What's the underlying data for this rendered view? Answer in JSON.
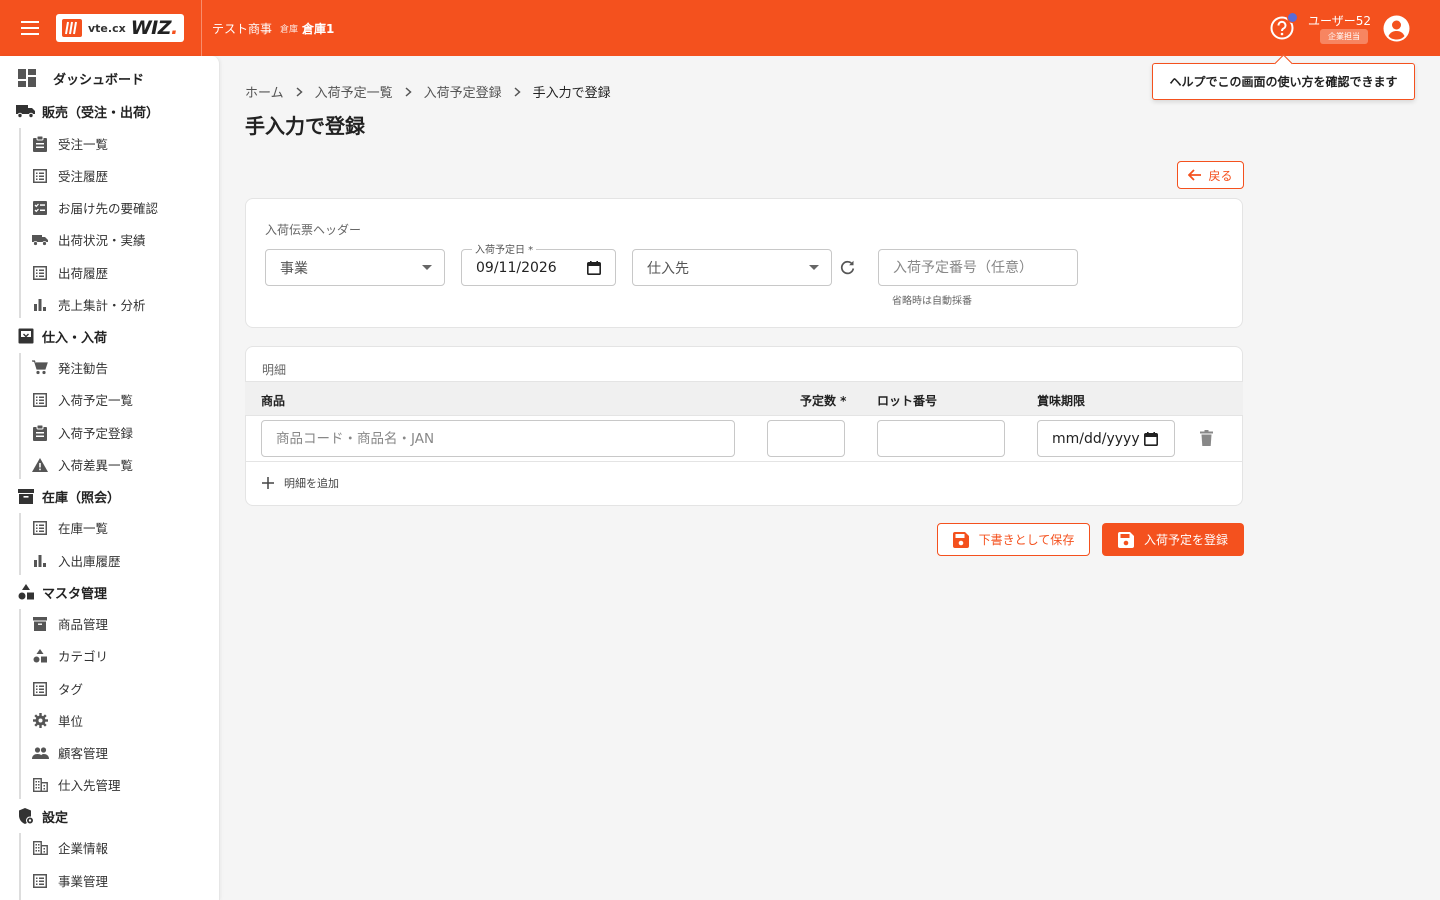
{
  "header": {
    "logo_vte": "vte.cx",
    "logo_wiz": "WIZ",
    "logo_dot": ".",
    "company": "テスト商事",
    "warehouse_label": "倉庫",
    "warehouse_value": "倉庫1",
    "user_name": "ユーザー52",
    "user_role": "企業担当",
    "help_tooltip": "ヘルプでこの画面の使い方を確認できます"
  },
  "sidebar": {
    "dashboard": "ダッシュボード",
    "sales": {
      "label": "販売（受注・出荷）",
      "items": [
        "受注一覧",
        "受注履歴",
        "お届け先の要確認",
        "出荷状況・実績",
        "出荷履歴",
        "売上集計・分析"
      ]
    },
    "purchase": {
      "label": "仕入・入荷",
      "items": [
        "発注勧告",
        "入荷予定一覧",
        "入荷予定登録",
        "入荷差異一覧"
      ]
    },
    "stock": {
      "label": "在庫（照会）",
      "items": [
        "在庫一覧",
        "入出庫履歴"
      ]
    },
    "master": {
      "label": "マスタ管理",
      "items": [
        "商品管理",
        "カテゴリ",
        "タグ",
        "単位",
        "顧客管理",
        "仕入先管理"
      ]
    },
    "settings": {
      "label": "設定",
      "items": [
        "企業情報",
        "事業管理"
      ]
    }
  },
  "breadcrumb": [
    "ホーム",
    "入荷予定一覧",
    "入荷予定登録",
    "手入力で登録"
  ],
  "page_title": "手入力で登録",
  "back_label": "戻る",
  "header_card": {
    "title": "入荷伝票ヘッダー",
    "business_placeholder": "事業",
    "date_label": "入荷予定日 *",
    "date_value": "09/11/2026",
    "supplier_placeholder": "仕入先",
    "number_placeholder": "入荷予定番号（任意）",
    "number_helper": "省略時は自動採番"
  },
  "detail_card": {
    "title": "明細",
    "columns": [
      "商品",
      "予定数 *",
      "ロット番号",
      "賞味期限"
    ],
    "product_placeholder": "商品コード・商品名・JAN",
    "qty_value": "",
    "lot_value": "",
    "expiry_placeholder": "mm/dd/yyyy",
    "add_row_label": "明細を追加"
  },
  "actions": {
    "draft_label": "下書きとして保存",
    "submit_label": "入荷予定を登録"
  },
  "colors": {
    "brand": "#f4511e",
    "badge": "#5b6bd6"
  }
}
